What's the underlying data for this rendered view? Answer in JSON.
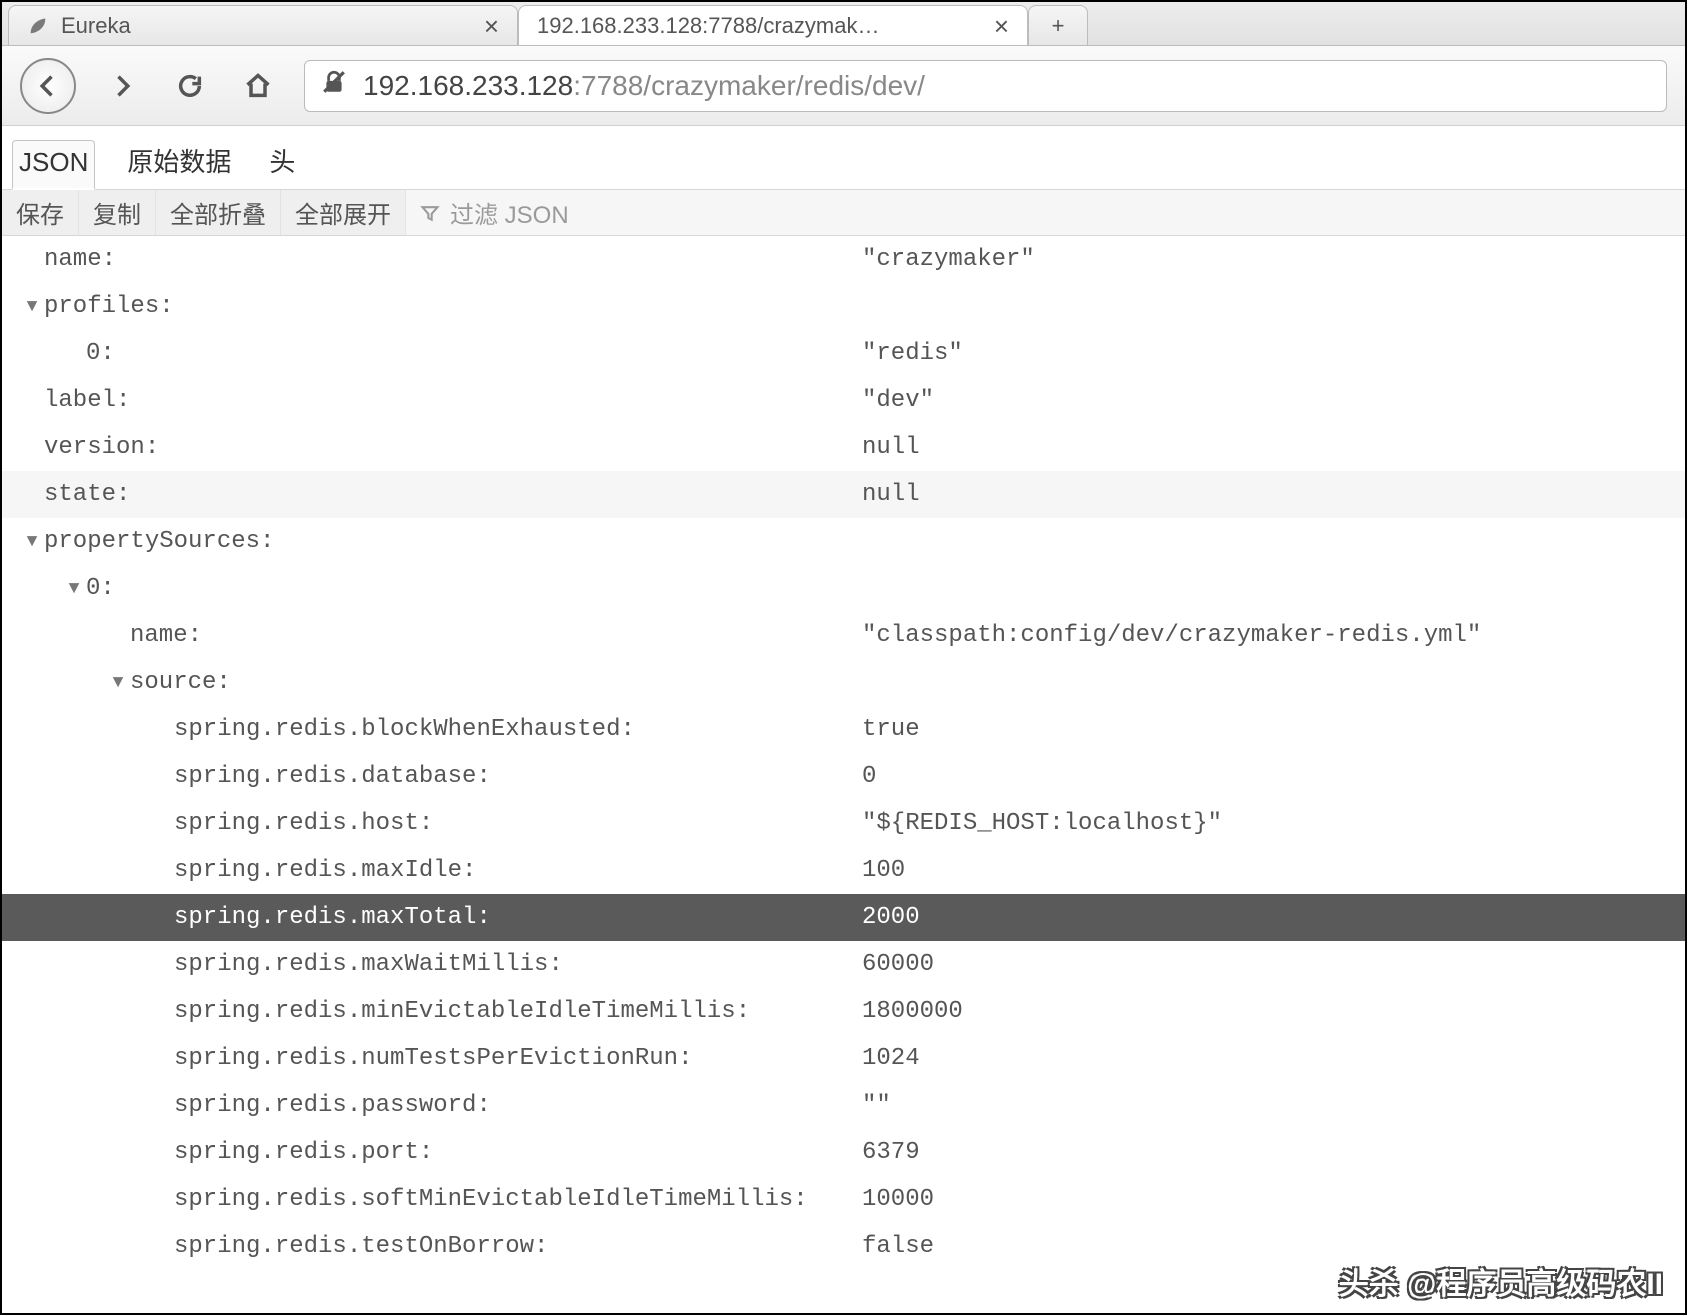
{
  "tabs": {
    "inactive": {
      "title": "Eureka",
      "favicon": "spring"
    },
    "active": {
      "title": "192.168.233.128:7788/crazymak…",
      "favicon": ""
    },
    "new": {
      "label": "+"
    }
  },
  "nav": {
    "url_host": "192.168.233.128",
    "url_port": ":7788",
    "url_path": "/crazymaker/redis/dev/"
  },
  "view_tabs": {
    "json": "JSON",
    "raw": "原始数据",
    "headers": "头"
  },
  "toolbar": {
    "save": "保存",
    "copy": "复制",
    "collapse_all": "全部折叠",
    "expand_all": "全部展开",
    "filter_placeholder": "过滤 JSON"
  },
  "json": {
    "name_key": "name:",
    "name_val": "\"crazymaker\"",
    "profiles_key": "profiles:",
    "profiles_0_key": "0:",
    "profiles_0_val": "\"redis\"",
    "label_key": "label:",
    "label_val": "\"dev\"",
    "version_key": "version:",
    "version_val": "null",
    "state_key": "state:",
    "state_val": "null",
    "propsrc_key": "propertySources:",
    "ps0_key": "0:",
    "ps0_name_key": "name:",
    "ps0_name_val": "\"classpath:config/dev/crazymaker-redis.yml\"",
    "ps0_source_key": "source:",
    "src": [
      {
        "k": "spring.redis.blockWhenExhausted:",
        "v": "true"
      },
      {
        "k": "spring.redis.database:",
        "v": "0"
      },
      {
        "k": "spring.redis.host:",
        "v": "\"${REDIS_HOST:localhost}\""
      },
      {
        "k": "spring.redis.maxIdle:",
        "v": "100"
      },
      {
        "k": "spring.redis.maxTotal:",
        "v": "2000",
        "selected": true
      },
      {
        "k": "spring.redis.maxWaitMillis:",
        "v": "60000"
      },
      {
        "k": "spring.redis.minEvictableIdleTimeMillis:",
        "v": "1800000"
      },
      {
        "k": "spring.redis.numTestsPerEvictionRun:",
        "v": "1024"
      },
      {
        "k": "spring.redis.password:",
        "v": "\"\""
      },
      {
        "k": "spring.redis.port:",
        "v": "6379"
      },
      {
        "k": "spring.redis.softMinEvictableIdleTimeMillis:",
        "v": "10000"
      },
      {
        "k": "spring.redis.testOnBorrow:",
        "v": "false"
      }
    ]
  },
  "watermark": "头杀 @程序员高级码农II"
}
